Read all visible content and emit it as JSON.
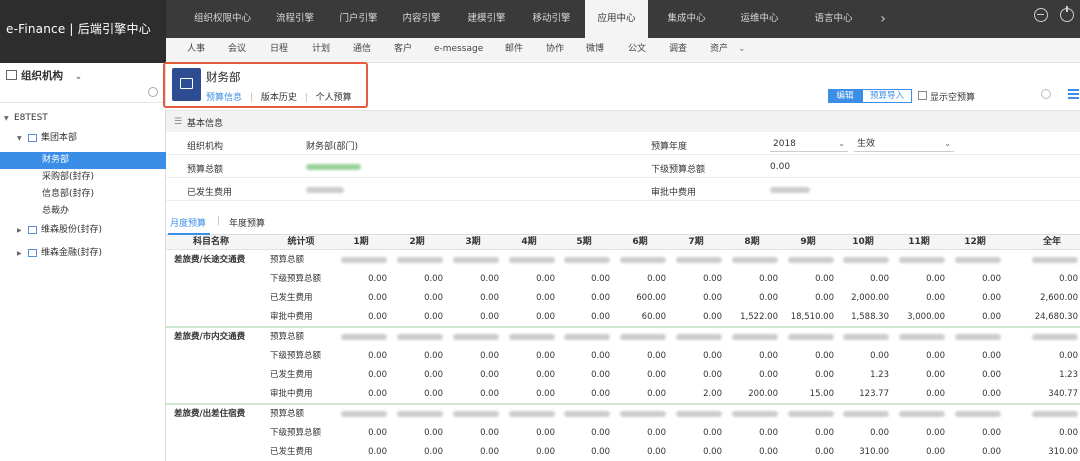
{
  "brand": "e-Finance | 后端引擎中心",
  "top_tabs": [
    "组织权限中心",
    "流程引擎",
    "门户引擎",
    "内容引擎",
    "建模引擎",
    "移动引擎",
    "应用中心",
    "集成中心",
    "运维中心",
    "语言中心"
  ],
  "top_active": "应用中心",
  "top_arrow": "›",
  "sub_tabs": [
    "人事",
    "会议",
    "日程",
    "计划",
    "通信",
    "客户",
    "e-message",
    "邮件",
    "协作",
    "微博",
    "公文",
    "调查",
    "资产"
  ],
  "sub_more": "⌄",
  "sidebar": {
    "title": "组织机构",
    "tree": [
      {
        "label": "E8TEST",
        "level": 0,
        "expanded": true,
        "selected": false
      },
      {
        "label": "集团本部",
        "level": 1,
        "expanded": true,
        "selected": false
      },
      {
        "label": "财务部",
        "level": 2,
        "selected": true
      },
      {
        "label": "采购部(封存)",
        "level": 2,
        "selected": false
      },
      {
        "label": "信息部(封存)",
        "level": 2,
        "selected": false
      },
      {
        "label": "总裁办",
        "level": 2,
        "selected": false
      },
      {
        "label": "维森股份(封存)",
        "level": 1,
        "expanded": false,
        "selected": false
      },
      {
        "label": "维森金融(封存)",
        "level": 1,
        "expanded": false,
        "selected": false
      }
    ]
  },
  "header": {
    "dept_name": "财务部",
    "links": [
      "预算信息",
      "版本历史",
      "个人预算"
    ],
    "edit_label": "编辑",
    "import_label": "预算导入",
    "show_empty_label": "显示空预算"
  },
  "basic_info": {
    "section_title": "基本信息",
    "org_label": "组织机构",
    "org_value": "财务部(部门)",
    "budget_total_label": "预算总额",
    "spent_label": "已发生费用",
    "year_label": "预算年度",
    "year_value": "2018",
    "status_value": "生效",
    "sub_total_label": "下级预算总额",
    "sub_total_value": "0.00",
    "pending_label": "审批中费用"
  },
  "tabs": [
    "月度预算",
    "年度预算"
  ],
  "table": {
    "headers": [
      "科目名称",
      "统计项",
      "1期",
      "2期",
      "3期",
      "4期",
      "5期",
      "6期",
      "7期",
      "8期",
      "9期",
      "10期",
      "11期",
      "12期",
      "全年"
    ],
    "groups": [
      {
        "name": "差旅费/长途交通费",
        "rows": [
          {
            "item": "预算总额",
            "values": [
              "",
              "",
              "",
              "",
              "",
              "",
              "",
              "",
              "",
              "",
              "",
              "",
              ""
            ]
          },
          {
            "item": "下级预算总额",
            "values": [
              "0.00",
              "0.00",
              "0.00",
              "0.00",
              "0.00",
              "0.00",
              "0.00",
              "0.00",
              "0.00",
              "0.00",
              "0.00",
              "0.00",
              "0.00"
            ]
          },
          {
            "item": "已发生费用",
            "values": [
              "0.00",
              "0.00",
              "0.00",
              "0.00",
              "0.00",
              "600.00",
              "0.00",
              "0.00",
              "0.00",
              "2,000.00",
              "0.00",
              "0.00",
              "2,600.00"
            ]
          },
          {
            "item": "审批中费用",
            "values": [
              "0.00",
              "0.00",
              "0.00",
              "0.00",
              "0.00",
              "60.00",
              "0.00",
              "1,522.00",
              "18,510.00",
              "1,588.30",
              "3,000.00",
              "0.00",
              "24,680.30"
            ]
          }
        ]
      },
      {
        "name": "差旅费/市内交通费",
        "rows": [
          {
            "item": "预算总额",
            "values": [
              "",
              "",
              "",
              "",
              "",
              "",
              "",
              "",
              "",
              "",
              "",
              "",
              ""
            ]
          },
          {
            "item": "下级预算总额",
            "values": [
              "0.00",
              "0.00",
              "0.00",
              "0.00",
              "0.00",
              "0.00",
              "0.00",
              "0.00",
              "0.00",
              "0.00",
              "0.00",
              "0.00",
              "0.00"
            ]
          },
          {
            "item": "已发生费用",
            "values": [
              "0.00",
              "0.00",
              "0.00",
              "0.00",
              "0.00",
              "0.00",
              "0.00",
              "0.00",
              "0.00",
              "1.23",
              "0.00",
              "0.00",
              "1.23"
            ]
          },
          {
            "item": "审批中费用",
            "values": [
              "0.00",
              "0.00",
              "0.00",
              "0.00",
              "0.00",
              "0.00",
              "2.00",
              "200.00",
              "15.00",
              "123.77",
              "0.00",
              "0.00",
              "340.77"
            ]
          }
        ]
      },
      {
        "name": "差旅费/出差住宿费",
        "rows": [
          {
            "item": "预算总额",
            "values": [
              "",
              "",
              "",
              "",
              "",
              "",
              "",
              "",
              "",
              "",
              "",
              "",
              ""
            ]
          },
          {
            "item": "下级预算总额",
            "values": [
              "0.00",
              "0.00",
              "0.00",
              "0.00",
              "0.00",
              "0.00",
              "0.00",
              "0.00",
              "0.00",
              "0.00",
              "0.00",
              "0.00",
              "0.00"
            ]
          },
          {
            "item": "已发生费用",
            "values": [
              "0.00",
              "0.00",
              "0.00",
              "0.00",
              "0.00",
              "0.00",
              "0.00",
              "0.00",
              "0.00",
              "310.00",
              "0.00",
              "0.00",
              "310.00"
            ]
          }
        ]
      }
    ]
  },
  "colors": {
    "accent": "#3a8ee6",
    "topbar": "#3a3a3a",
    "highlight_box": "#e35c3d",
    "dept_icon": "#2e4c91"
  }
}
